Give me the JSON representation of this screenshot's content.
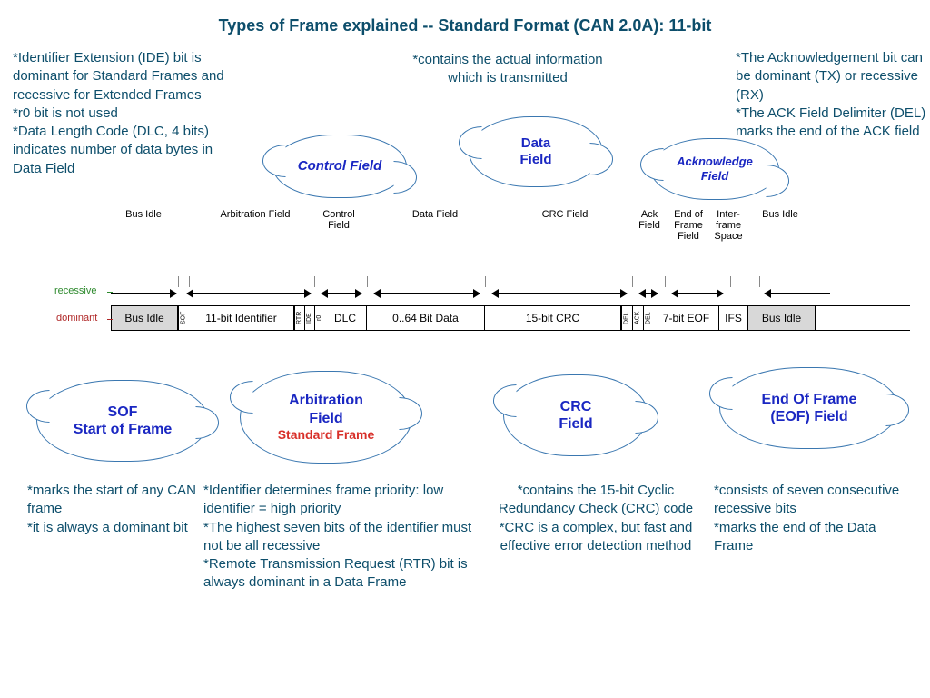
{
  "title": "Types of Frame explained -- Standard Format (CAN 2.0A): 11-bit",
  "notes": {
    "control": "*Identifier Extension (IDE) bit is dominant for Standard Frames and recessive for Extended Frames\n*r0 bit is not used\n*Data Length Code (DLC, 4 bits) indicates number of data bytes in Data Field",
    "data": "*contains the actual information which is transmitted",
    "ack": "*The Acknowledgement bit can be dominant (TX) or recessive (RX)\n*The ACK Field Delimiter (DEL) marks the end of the ACK field",
    "sof": "*marks the start of any CAN frame\n *it is always a dominant bit",
    "arb": "*Identifier determines frame priority: low identifier = high priority\n*The highest seven bits of the identifier must not be all recessive\n*Remote Transmission Request (RTR) bit is always dominant in a Data Frame",
    "crc": "*contains the 15-bit Cyclic Redundancy Check (CRC) code\n*CRC is a complex, but fast and effective error detection method",
    "eof": "*consists of seven consecutive recessive bits\n*marks the end of the Data Frame"
  },
  "clouds": {
    "control": "Control Field",
    "data": "Data\nField",
    "ack": "Acknowledge\nField",
    "sof": "SOF\nStart of Frame",
    "arb_title": "Arbitration\nField",
    "arb_sub": "Standard Frame",
    "crc": "CRC\nField",
    "eof": "End Of Frame\n(EOF) Field"
  },
  "levels": {
    "recessive": "recessive",
    "dominant": "dominant"
  },
  "sections": {
    "bus_idle_l": "Bus Idle",
    "arb": "Arbitration Field",
    "control": "Control\nField",
    "data": "Data Field",
    "crc": "CRC Field",
    "ack": "Ack\nField",
    "eof": "End of\nFrame\nField",
    "ifs": "Inter-\nframe\nSpace",
    "bus_idle_r": "Bus Idle"
  },
  "frame": {
    "bus_idle_l": "Bus Idle",
    "sof": "SOF",
    "identifier": "11-bit Identifier",
    "rtr": "RTR",
    "ide": "IDE",
    "r0": "r0",
    "dlc": "DLC",
    "data": "0..64 Bit Data",
    "crc": "15-bit CRC",
    "del1": "DEL",
    "ack": "ACK",
    "del2": "DEL",
    "eof": "7-bit EOF",
    "ifs": "IFS",
    "bus_idle_r": "Bus Idle"
  }
}
